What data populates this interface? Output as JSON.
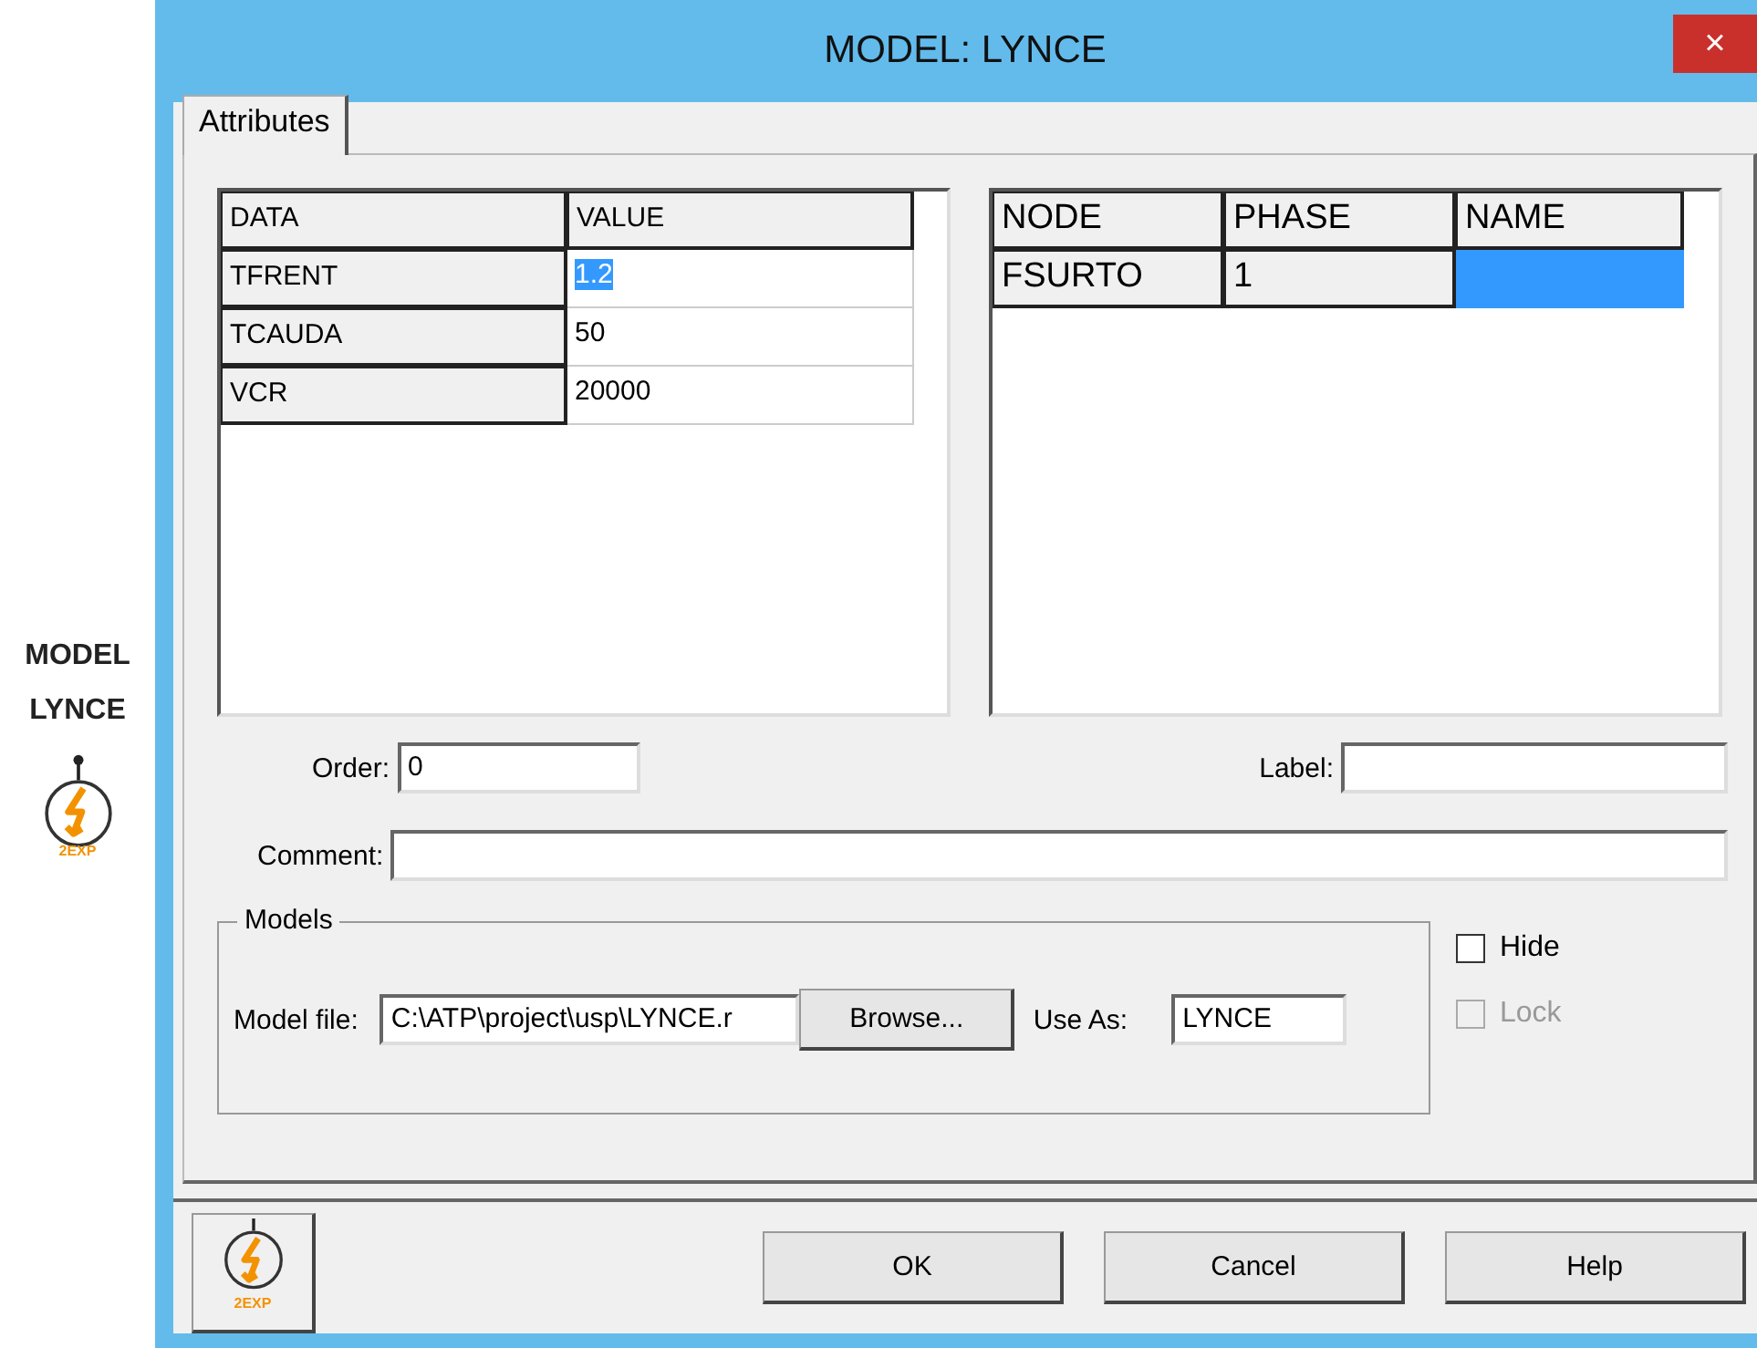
{
  "canvas_label": {
    "lines": [
      "MODEL",
      "LYNCE"
    ],
    "icon_caption": "2EXP"
  },
  "window": {
    "title": "MODEL: LYNCE",
    "close": "×"
  },
  "tabs": [
    {
      "label": "Attributes",
      "selected": true
    }
  ],
  "data_table": {
    "columns": [
      "DATA",
      "VALUE"
    ],
    "rows": [
      {
        "name": "TFRENT",
        "value": "1.2",
        "selected": true
      },
      {
        "name": "TCAUDA",
        "value": "50",
        "selected": false
      },
      {
        "name": "VCR",
        "value": "20000",
        "selected": false
      }
    ]
  },
  "node_table": {
    "columns": [
      "NODE",
      "PHASE",
      "NAME"
    ],
    "rows": [
      {
        "node": "FSURTO",
        "phase": "1",
        "name_selected": true
      }
    ]
  },
  "order": {
    "label": "Order:",
    "value": "0"
  },
  "label_field": {
    "label": "Label:"
  },
  "comment": {
    "label": "Comment:"
  },
  "models": {
    "title": "Models",
    "model_file_label": "Model file:",
    "model_file": "C:\\ATP\\project\\usp\\LYNCE.r",
    "browse": "Browse...",
    "use_as_label": "Use As:",
    "use_as": "LYNCE"
  },
  "checkboxes": [
    {
      "label": "Hide",
      "checked": false,
      "disabled": false
    },
    {
      "label": "Lock",
      "checked": false,
      "disabled": true
    }
  ],
  "footer": {
    "icon_caption": "2EXP",
    "buttons": [
      "OK",
      "Cancel",
      "Help"
    ]
  }
}
